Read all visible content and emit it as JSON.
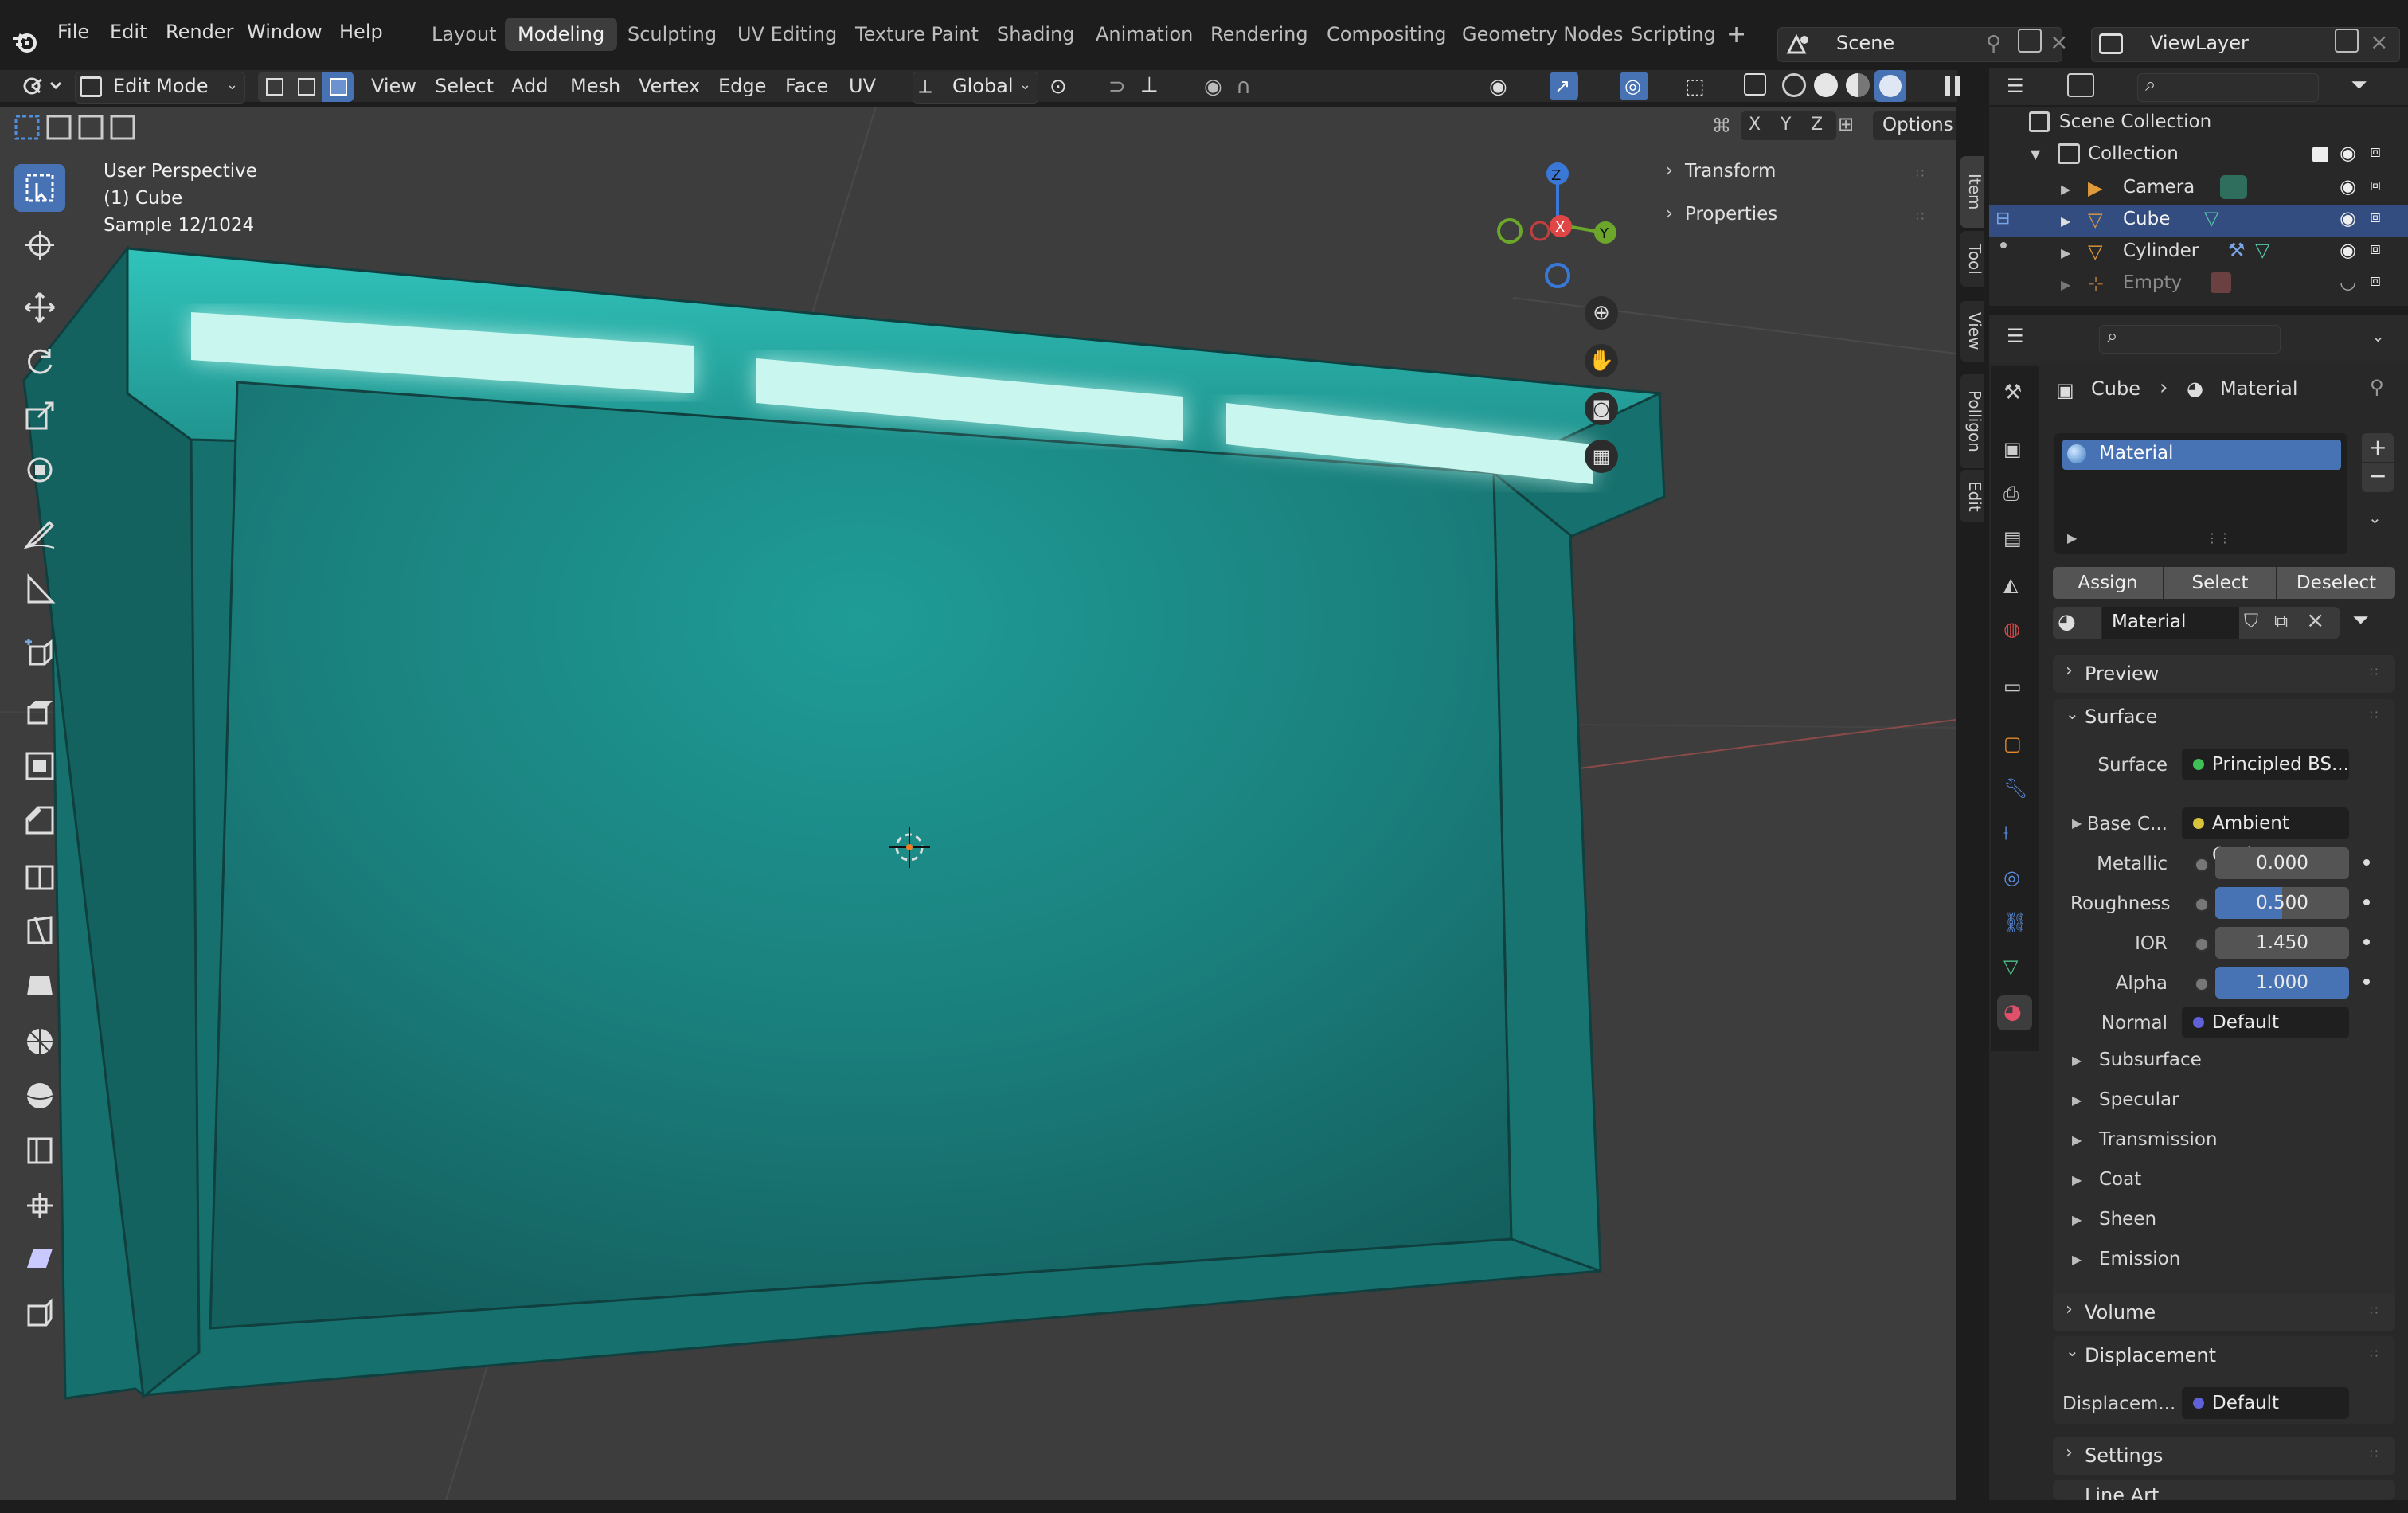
{
  "menu": {
    "items": [
      "File",
      "Edit",
      "Render",
      "Window",
      "Help"
    ]
  },
  "workspaces": {
    "tabs": [
      "Layout",
      "Modeling",
      "Sculpting",
      "UV Editing",
      "Texture Paint",
      "Shading",
      "Animation",
      "Rendering",
      "Compositing",
      "Geometry Nodes",
      "Scripting"
    ],
    "active": "Modeling"
  },
  "scene": {
    "name": "Scene"
  },
  "view_layer": {
    "name": "ViewLayer"
  },
  "viewport_header": {
    "mode": "Edit Mode",
    "menus": [
      "View",
      "Select",
      "Add",
      "Mesh",
      "Vertex",
      "Edge",
      "Face",
      "UV"
    ],
    "orientation": "Global",
    "options_label": "Options",
    "axes": [
      "X",
      "Y",
      "Z"
    ]
  },
  "viewport_overlay": {
    "perspective": "User Perspective",
    "object": "(1) Cube",
    "sample": "Sample 12/1024"
  },
  "gizmo": {
    "x": "X",
    "y": "Y",
    "z": "Z"
  },
  "npanel": {
    "sections": [
      "Transform",
      "Properties"
    ],
    "tabs": [
      "Item",
      "Tool",
      "View",
      "Polligon",
      "Edit"
    ]
  },
  "outliner": {
    "root": "Scene Collection",
    "collection": "Collection",
    "objects": [
      {
        "name": "Camera",
        "icon": "camera-icon",
        "selected": false,
        "dim": false
      },
      {
        "name": "Cube",
        "icon": "mesh-icon",
        "selected": true,
        "dim": false
      },
      {
        "name": "Cylinder",
        "icon": "mesh-icon",
        "selected": false,
        "dim": false
      },
      {
        "name": "Empty",
        "icon": "empty-icon",
        "selected": false,
        "dim": true
      }
    ]
  },
  "properties": {
    "breadcrumb": [
      "Cube",
      "Material"
    ],
    "slot": "Material",
    "buttons": [
      "Assign",
      "Select",
      "Deselect"
    ],
    "material_name": "Material",
    "sections": {
      "preview": "Preview",
      "surface": "Surface",
      "volume": "Volume",
      "displacement": "Displacement",
      "settings": "Settings",
      "line_art": "Line Art"
    },
    "surface_fields": [
      {
        "label": "Surface",
        "value": "Principled BS...",
        "type": "link",
        "color": "#3fbf56"
      },
      {
        "label": "Base C...",
        "value": "Ambient Occl...",
        "type": "link",
        "color": "#d8c43a",
        "expandable": true
      },
      {
        "label": "Metallic",
        "value": "0.000",
        "type": "number",
        "fill": 0.0
      },
      {
        "label": "Roughness",
        "value": "0.500",
        "type": "number",
        "fill": 0.5
      },
      {
        "label": "IOR",
        "value": "1.450",
        "type": "number",
        "fill": 0.0
      },
      {
        "label": "Alpha",
        "value": "1.000",
        "type": "number",
        "fill": 1.0
      },
      {
        "label": "Normal",
        "value": "Default",
        "type": "link",
        "color": "#6060d8"
      }
    ],
    "subpanels": [
      "Subsurface",
      "Specular",
      "Transmission",
      "Coat",
      "Sheen",
      "Emission"
    ],
    "displacement_field": {
      "label": "Displacem...",
      "value": "Default",
      "color": "#6060d8"
    }
  },
  "colors": {
    "accent": "#4772b3",
    "mesh_teal": "#1f8a86",
    "glow": "#bff3ea",
    "viewport_bg": "#3d3d3d"
  }
}
